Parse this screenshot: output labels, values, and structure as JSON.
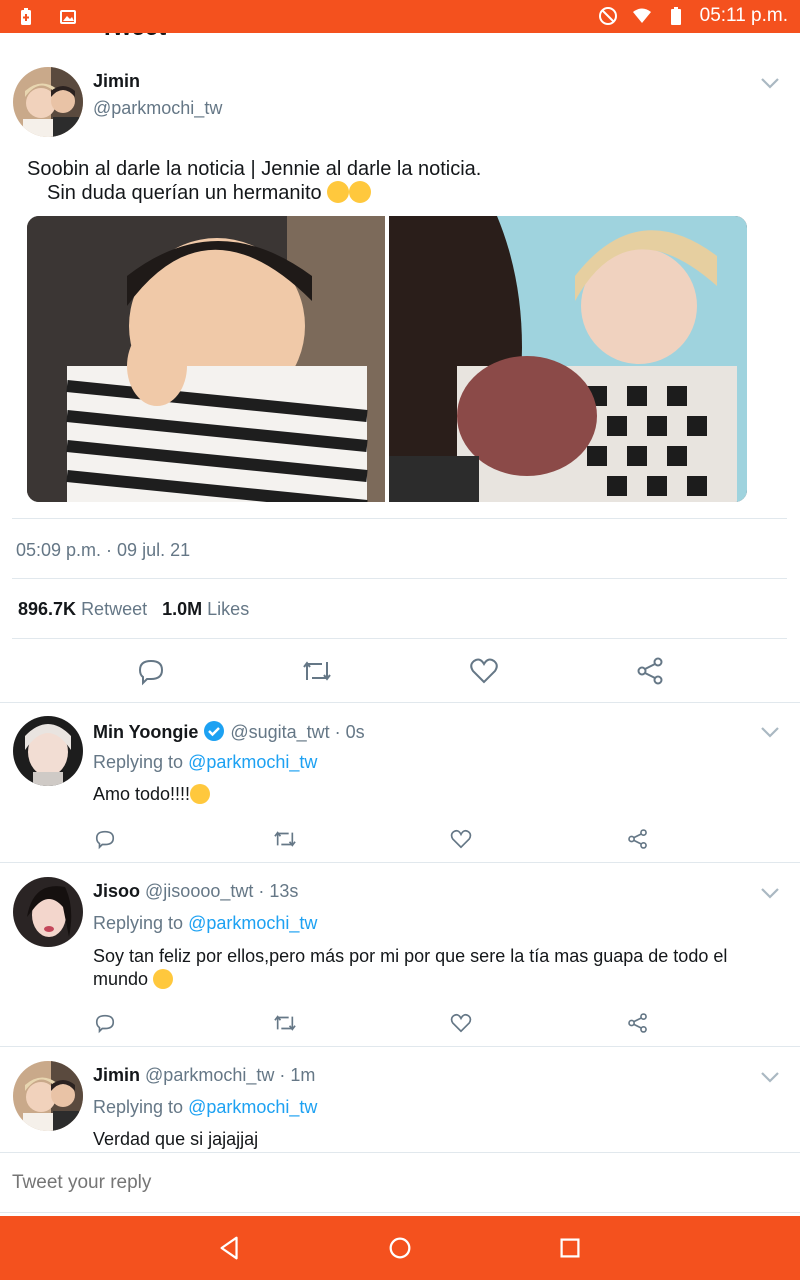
{
  "status_bar": {
    "time": "05:11 p.m."
  },
  "header": {
    "title": "Tweet"
  },
  "main_tweet": {
    "author_name": "Jimin",
    "author_handle": "@parkmochi_tw",
    "text_line1": "Soobin al darle la noticia | Jennie al darle la noticia.",
    "text_line2": "Sin duda querían un hermanito",
    "timestamp": "05:09 p.m. · 09 jul. 21",
    "retweets_count": "896.7K",
    "retweets_label": "Retweet",
    "likes_count": "1.0M",
    "likes_label": "Likes"
  },
  "replies": [
    {
      "name": "Min Yoongie",
      "handle_time": "@sugita_twt · 0s",
      "verified": true,
      "replying_label": "Replying to",
      "replying_handle": "@parkmochi_tw",
      "text": "Amo todo!!!!"
    },
    {
      "name": "Jisoo",
      "handle_time": "@jisoooo_twt · 13s",
      "verified": false,
      "replying_label": "Replying to",
      "replying_handle": "@parkmochi_tw",
      "text_line1": "Soy tan feliz por ellos,pero más por mi por que sere la tía mas guapa de todo el",
      "text_line2": "mundo"
    },
    {
      "name": "Jimin",
      "handle_time": "@parkmochi_tw · 1m",
      "verified": false,
      "replying_label": "Replying to",
      "replying_handle": "@parkmochi_tw",
      "text": "Verdad que si jajajjaj"
    }
  ],
  "reply_input": {
    "placeholder": "Tweet your reply"
  },
  "colors": {
    "accent": "#f4511e",
    "link": "#1da1f2",
    "muted": "#657786"
  }
}
